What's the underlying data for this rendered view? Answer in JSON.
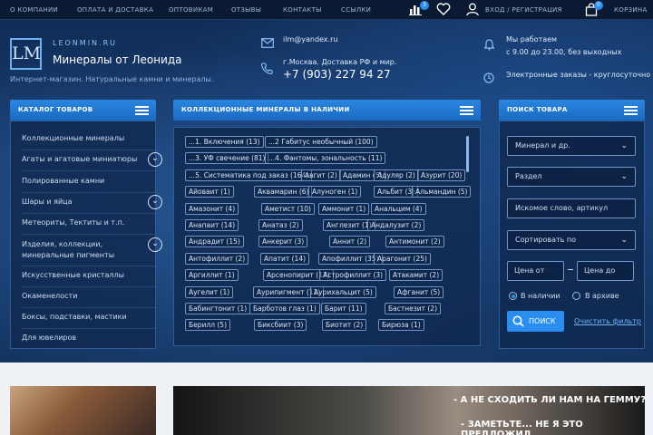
{
  "topnav": {
    "links": [
      "О КОМПАНИИ",
      "ОПЛАТА И ДОСТАВКА",
      "ОПТОВИКАМ",
      "ОТЗЫВЫ",
      "КОНТАКТЫ",
      "ССЫЛКИ"
    ],
    "compare_count": "3",
    "login": "ВХОД / РЕГИСТРАЦИЯ",
    "cart_count": "0",
    "cart": "КОРЗИНА"
  },
  "header": {
    "logo_letters": "LM",
    "url": "LEONMIN.RU",
    "name": "Минералы от Леонида",
    "tagline": "Интернет-магазин. Натуральные камни и минералы.",
    "email": "ilm@yandex.ru",
    "address": "г.Москва. Доставка РФ и мир.",
    "phone": "+7 (903) 227 94 27",
    "hours_title": "Мы работаем",
    "hours": "с 9.00 до 23.00, без выходных",
    "online_orders": "Электронные заказы - круглосуточно"
  },
  "catalog": {
    "title": "КАТАЛОГ ТОВАРОВ",
    "items": [
      "Коллекционные минералы",
      "Агаты и агатовые миниатюры",
      "Полированные камни",
      "Шары и яйца",
      "Метеориты, Тектиты и т.п.",
      "Изделия, коллекции,",
      "минеральные пигменты",
      "Искусственные кристаллы",
      "Окаменелости",
      "Боксы, подставки, мастики",
      "Для ювелиров"
    ]
  },
  "minerals": {
    "title": "КОЛЛЕКЦИОННЫЕ МИНЕРАЛЫ В НАЛИЧИИ",
    "tags": [
      "...1. Включения (13)",
      "...2 Габитус необычный (100)",
      "...3. УФ свечение (81)",
      "...4. Фантомы, зональность (11)",
      "...5. Систематика под заказ (164)",
      "Авгит (2)",
      "Адамин (5)",
      "Адуляр (2)",
      "Азурит (20)",
      "Айоваит (1)",
      "Аквамарин (6)",
      "Алуноген (1)",
      "Альбит (3)",
      "Альмандин (5)",
      "Амазонит (4)",
      "Аметист (10)",
      "Аммонит (1)",
      "Анальцим (4)",
      "Анапаит (14)",
      "Анатаз (2)",
      "Англезит (1)",
      "Андалузит (2)",
      "Андрадит (15)",
      "Анкерит (3)",
      "Аннит (2)",
      "Антимонит (2)",
      "Антофиллит (2)",
      "Апатит (14)",
      "Апофиллит (35)",
      "Арагонит (25)",
      "Аргиллит (1)",
      "Арсенопирит (17)",
      "Астрофиллит (3)",
      "Атакамит (2)",
      "Аугелит (1)",
      "Аурипигмент (11)",
      "Аурихальцит (5)",
      "Афганит (5)",
      "Бабингтонит (1)",
      "Барботов глаз (1)",
      "Барит (11)",
      "Бастнезит (2)",
      "Берилл (5)",
      "Биксбиит (3)",
      "Биотит (2)",
      "Бирюза (1)"
    ]
  },
  "search": {
    "title": "ПОИСК ТОВАРА",
    "mineral_placeholder": "Минерал и др.",
    "section_placeholder": "Раздел",
    "keyword_placeholder": "Искомое слово, артикул",
    "sort_placeholder": "Сортировать по",
    "price_from": "Цена от",
    "price_to": "Цена до",
    "radio_in_stock": "В наличии",
    "radio_archive": "В архиве",
    "button": "ПОИСК",
    "reset": "Очистить фильтр"
  },
  "banner": {
    "line1": "- А НЕ СХОДИТЬ ЛИ НАМ НА ГЕММУ?",
    "line2": "- ЗАМЕТЬТЕ... НЕ Я ЭТО ПРЕДЛОЖИЛ."
  },
  "colors": {
    "accent": "#2a8df0",
    "panel": "#1b6ac2",
    "page_bg": "#0f2a52"
  }
}
